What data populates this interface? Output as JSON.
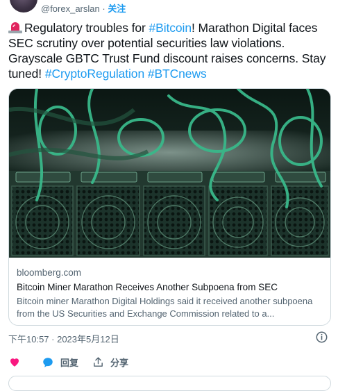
{
  "author": {
    "handle": "@forex_arslan",
    "separator": " · ",
    "follow_label": "关注"
  },
  "tweet": {
    "parts": [
      {
        "text": "Regulatory troubles for ",
        "tag": false
      },
      {
        "text": "#Bitcoin",
        "tag": true
      },
      {
        "text": "! Marathon Digital faces SEC scrutiny over potential securities law violations. Grayscale GBTC Trust Fund discount raises concerns. Stay tuned! ",
        "tag": false
      },
      {
        "text": "#CryptoRegulation",
        "tag": true
      },
      {
        "text": " ",
        "tag": false
      },
      {
        "text": "#BTCnews",
        "tag": true
      }
    ]
  },
  "card": {
    "domain": "bloomberg.com",
    "title": "Bitcoin Miner Marathon Receives Another Subpoena from SEC",
    "description": "Bitcoin miner Marathon Digital Holdings said it received another subpoena from the US Securities and Exchange Commission related to a..."
  },
  "timestamp": "下午10:57 · 2023年5月12日",
  "actions": {
    "reply_label": "回复",
    "share_label": "分享"
  },
  "colors": {
    "accent": "#1d9bf0",
    "like": "#f91880",
    "text": "#0f1419",
    "muted": "#536471"
  },
  "icons": [
    "siren-emoji-icon",
    "like-icon",
    "reply-icon",
    "share-icon",
    "info-icon"
  ]
}
